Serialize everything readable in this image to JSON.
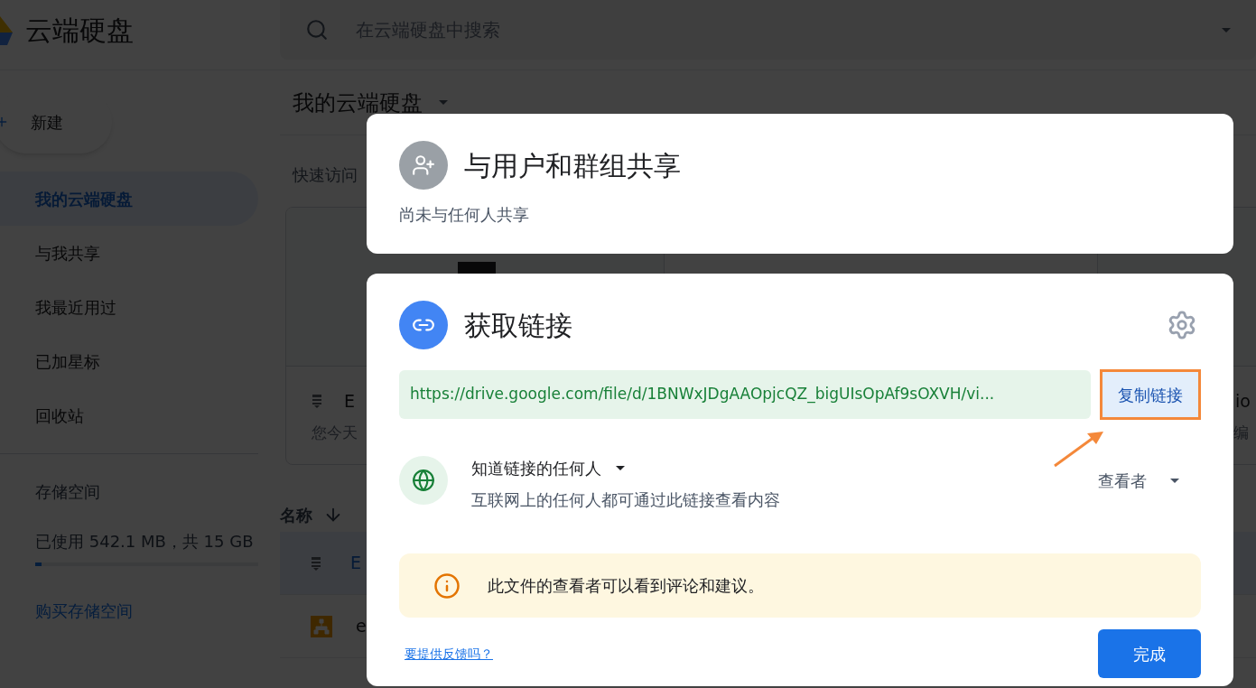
{
  "app": {
    "title": "云端硬盘",
    "search_placeholder": "在云端硬盘中搜索"
  },
  "sidebar": {
    "new_button": "新建",
    "items": [
      {
        "label": "我的云端硬盘",
        "selected": true
      },
      {
        "label": "与我共享",
        "selected": false
      },
      {
        "label": "我最近用过",
        "selected": false
      },
      {
        "label": "已加星标",
        "selected": false
      },
      {
        "label": "回收站",
        "selected": false
      }
    ],
    "storage": {
      "label": "存储空间",
      "usage": "已使用 542.1 MB，共 15 GB",
      "level": 0.03,
      "buy_link": "购买存储空间"
    }
  },
  "main": {
    "title": "我的云端硬盘",
    "quick_access_label": "快速访问",
    "quick_cards": [
      {
        "title": "E",
        "subtitle": "您今天"
      },
      {
        "title": "io",
        "subtitle": "编"
      }
    ],
    "list_header": "名称",
    "files": [
      {
        "name": "E",
        "selected": true,
        "kind": "doc"
      },
      {
        "name": "e",
        "selected": false,
        "kind": "diagram"
      }
    ]
  },
  "share_dialog": {
    "title": "与用户和群组共享",
    "subtitle": "尚未与任何人共享"
  },
  "link_dialog": {
    "title": "获取链接",
    "url": "https://drive.google.com/file/d/1BNWxJDgAAOpjcQZ_bigUIsOpAf9sOXVH/vi...",
    "copy_button": "复制链接",
    "access": "知道链接的任何人",
    "access_description": "互联网上的任何人都可通过此链接查看内容",
    "role": "查看者",
    "notice": "此文件的查看者可以看到评论和建议。",
    "feedback_link": "要提供反馈吗？",
    "done_button": "完成"
  }
}
